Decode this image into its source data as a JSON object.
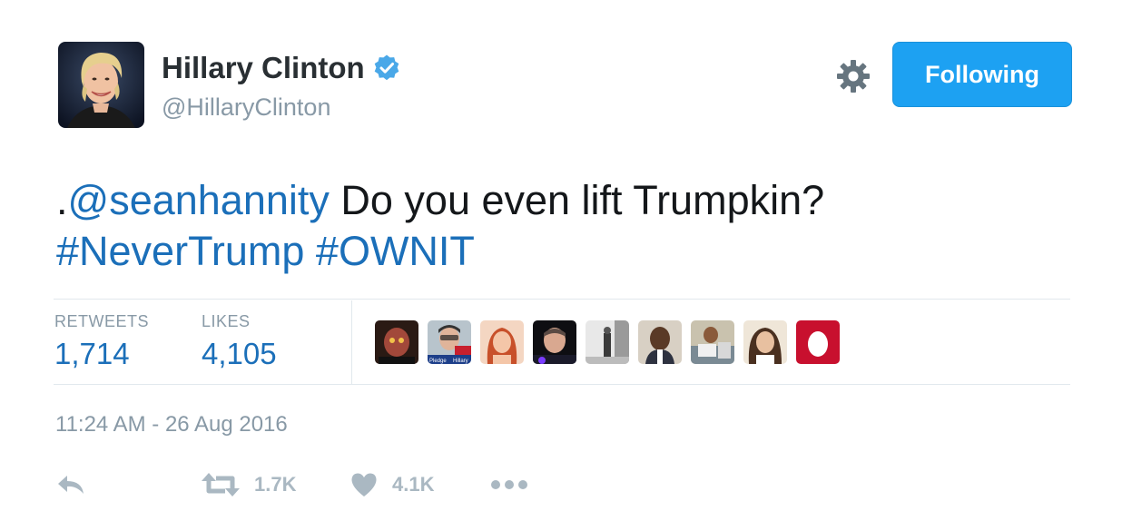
{
  "user": {
    "display_name": "Hillary Clinton",
    "handle": "@HillaryClinton",
    "verified_icon": "verified-badge-icon"
  },
  "header": {
    "settings_icon": "gear-icon",
    "follow_label": "Following"
  },
  "tweet": {
    "line1_prefix": ".",
    "mention": "@seanhannity",
    "line1_rest": " Do you even lift Trumpkin?",
    "hashtag1": "#NeverTrump",
    "hashtag2": "#OWNIT"
  },
  "stats": {
    "retweets_label": "RETWEETS",
    "retweets_value": "1,714",
    "likes_label": "LIKES",
    "likes_value": "4,105",
    "liker_badge_labels": [
      "Pledge",
      "Hillary"
    ]
  },
  "timestamp": "11:24 AM - 26 Aug 2016",
  "actions": {
    "reply_icon": "reply-icon",
    "retweet_icon": "retweet-icon",
    "retweet_count": "1.7K",
    "like_icon": "heart-icon",
    "like_count": "4.1K",
    "more_icon": "more-dots-icon"
  },
  "colors": {
    "accent": "#1da1f2",
    "link": "#1b6fb9",
    "muted": "#8899a6",
    "action_gray": "#aab8c2",
    "verified": "#4aa8e8"
  }
}
